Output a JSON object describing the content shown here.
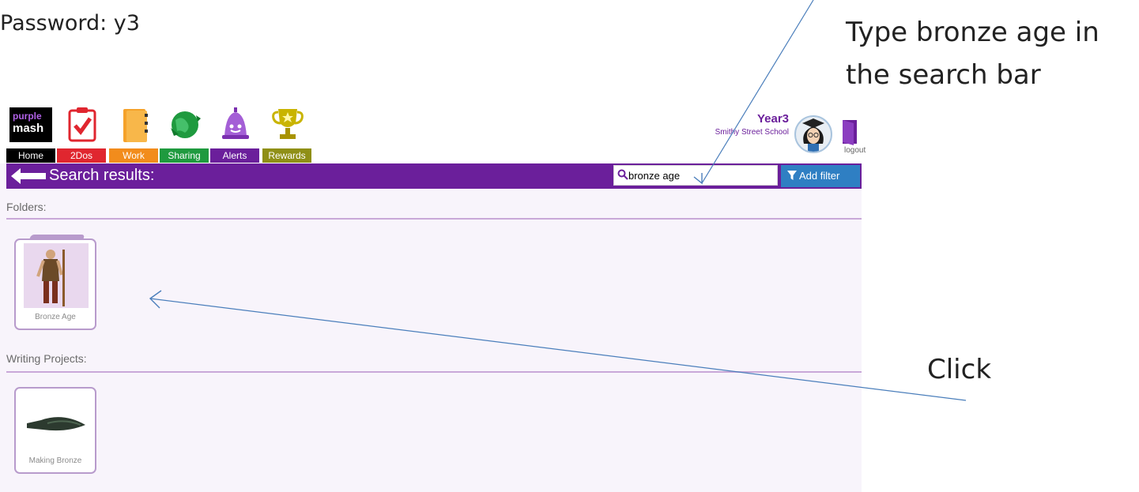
{
  "annotations": {
    "password": "Password: y3",
    "search_instruction_line1": "Type bronze age in",
    "search_instruction_line2": "the search bar",
    "click_instruction": "Click"
  },
  "nav": {
    "items": [
      {
        "label": "Home",
        "icon": "purple-mash-logo-icon",
        "color": "#000000"
      },
      {
        "label": "2Dos",
        "icon": "clipboard-check-icon",
        "color": "#e0262f"
      },
      {
        "label": "Work",
        "icon": "folder-icon",
        "color": "#f28c1c"
      },
      {
        "label": "Sharing",
        "icon": "globe-icon",
        "color": "#1f9a3f"
      },
      {
        "label": "Alerts",
        "icon": "bell-icon",
        "color": "#6b1f9b"
      },
      {
        "label": "Rewards",
        "icon": "trophy-icon",
        "color": "#8f8f16"
      }
    ],
    "logo_text_top": "purple",
    "logo_text_bottom": "mash"
  },
  "user": {
    "name": "Year3",
    "school": "Smithy Street School",
    "logout_label": "logout"
  },
  "search": {
    "title": "Search results:",
    "query": "bronze age",
    "add_filter_label": "Add filter"
  },
  "sections": {
    "folders_title": "Folders:",
    "folders": [
      {
        "label": "Bronze Age"
      }
    ],
    "writing_title": "Writing Projects:",
    "writing": [
      {
        "label": "Making Bronze"
      }
    ]
  },
  "colors": {
    "brand_purple": "#6b1f9b",
    "filter_blue": "#2f7fc3",
    "annotation_arrow": "#4a7ebb"
  }
}
